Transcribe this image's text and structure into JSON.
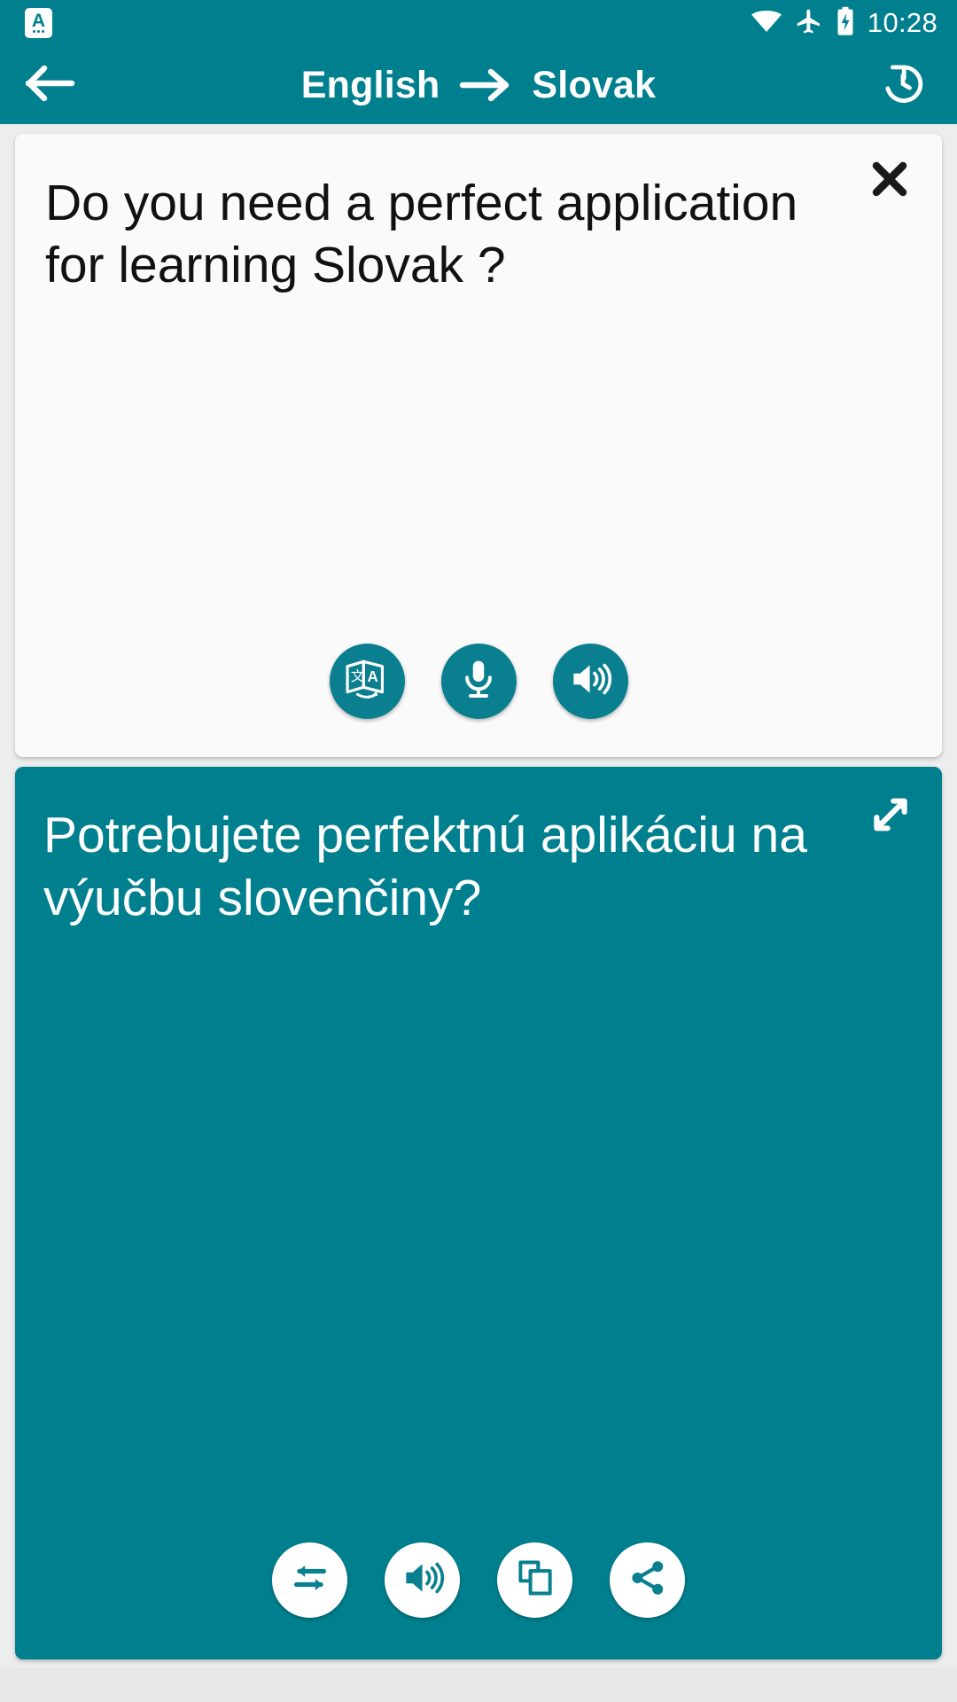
{
  "status_bar": {
    "notification_icon": "app-letter-a-icon",
    "notification_letter": "A",
    "wifi_icon": "wifi-icon",
    "airplane_icon": "airplane-mode-icon",
    "battery_icon": "battery-charging-icon",
    "time": "10:28"
  },
  "app_bar": {
    "back_icon": "back-arrow-icon",
    "source_language": "English",
    "direction_icon": "arrow-right-icon",
    "target_language": "Slovak",
    "history_icon": "history-icon"
  },
  "source_card": {
    "text": "Do you need a perfect application for learning Slovak ?",
    "close_icon": "close-icon",
    "actions": [
      {
        "name": "translate-button",
        "icon": "translate-icon"
      },
      {
        "name": "microphone-button",
        "icon": "microphone-icon"
      },
      {
        "name": "speak-source-button",
        "icon": "speaker-icon"
      }
    ]
  },
  "target_card": {
    "text": "Potrebujete perfektnú aplikáciu na výučbu slovenčiny?",
    "expand_icon": "expand-fullscreen-icon",
    "actions": [
      {
        "name": "swap-languages-button",
        "icon": "swap-arrows-icon"
      },
      {
        "name": "speak-translation-button",
        "icon": "speaker-icon"
      },
      {
        "name": "copy-button",
        "icon": "copy-icon"
      },
      {
        "name": "share-button",
        "icon": "share-icon"
      }
    ]
  },
  "colors": {
    "primary_teal": "#00808f",
    "fab_teal": "#0a7f8f",
    "card_background": "#fafafa",
    "screen_background": "#eceded",
    "text_dark": "#111111",
    "text_light": "#ffffff"
  }
}
